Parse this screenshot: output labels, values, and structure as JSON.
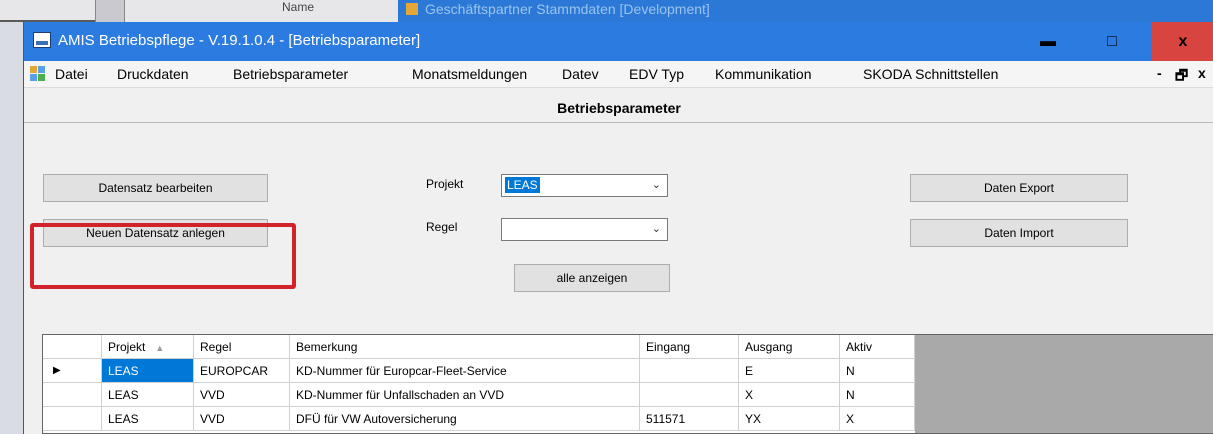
{
  "background": {
    "column_header": "Name",
    "window_title": "Geschäftspartner Stammdaten [Development]"
  },
  "window": {
    "title": "AMIS Betriebspflege - V.19.1.0.4 - [Betriebsparameter]",
    "minimize_glyph": "▬",
    "maximize_glyph": "□",
    "close_glyph": "x"
  },
  "menu": {
    "items": [
      "Datei",
      "Druckdaten",
      "Betriebsparameter",
      "Monatsmeldungen",
      "Datev",
      "EDV Typ",
      "Kommunikation",
      "SKODA Schnittstellen"
    ],
    "mdi_minimize": "-",
    "mdi_restore": "🗗",
    "mdi_close": "x"
  },
  "form": {
    "header": "Betriebsparameter",
    "edit_button": "Datensatz bearbeiten",
    "new_button": "Neuen Datensatz anlegen",
    "projekt_label": "Projekt",
    "projekt_value": "LEAS",
    "regel_label": "Regel",
    "regel_value": "",
    "show_all_button": "alle anzeigen",
    "export_button": "Daten Export",
    "import_button": "Daten Import"
  },
  "grid": {
    "columns": [
      "Projekt",
      "Regel",
      "Bemerkung",
      "Eingang",
      "Ausgang",
      "Aktiv"
    ],
    "sort_indicator": "▲",
    "current_row_marker": "▶",
    "rows": [
      [
        "LEAS",
        "EUROPCAR",
        "KD-Nummer für Europcar-Fleet-Service",
        "",
        "E",
        "N"
      ],
      [
        "LEAS",
        "VVD",
        "KD-Nummer für Unfallschaden an VVD",
        "",
        "X",
        "N"
      ],
      [
        "LEAS",
        "VVD",
        "DFÜ für VW Autoversicherung",
        "511571",
        "YX",
        "X"
      ]
    ]
  },
  "colors": {
    "titlebar": "#2c7be0",
    "close_button": "#d8443f",
    "selection": "#0078d7",
    "highlight_box": "#d2232a"
  }
}
